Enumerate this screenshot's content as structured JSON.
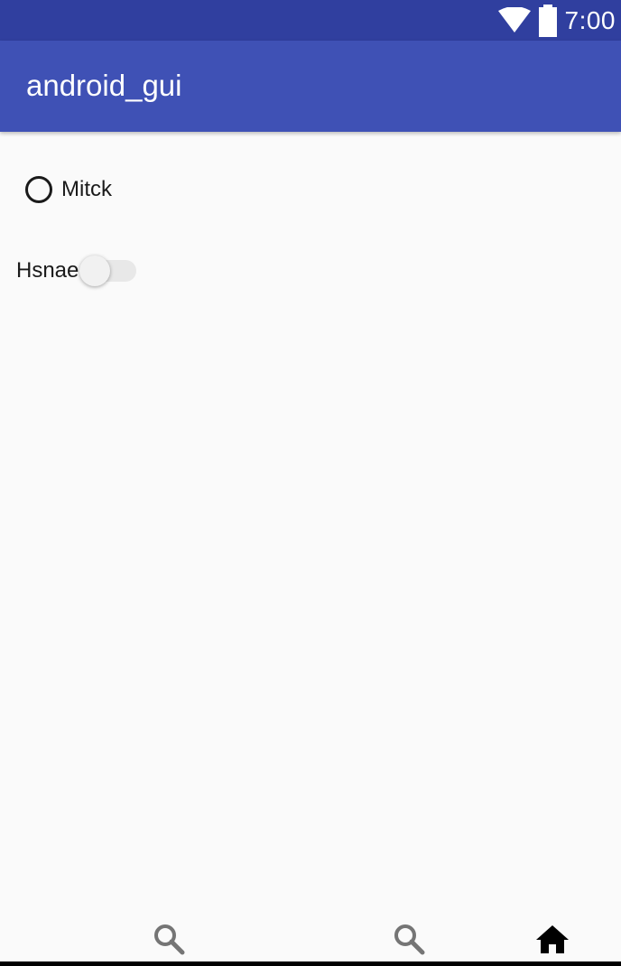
{
  "status_bar": {
    "time": "7:00",
    "icons": [
      "wifi-icon",
      "battery-icon"
    ],
    "color": "#303f9f"
  },
  "app_bar": {
    "title": "android_gui",
    "color": "#3f51b5"
  },
  "content": {
    "radio": {
      "label": "Mitck",
      "checked": false
    },
    "switch": {
      "label": "Hsnae",
      "on": false
    }
  },
  "bottom_nav": {
    "items": [
      {
        "icon": "search-icon"
      },
      {
        "icon": "search-icon"
      },
      {
        "icon": "home-icon"
      }
    ]
  }
}
